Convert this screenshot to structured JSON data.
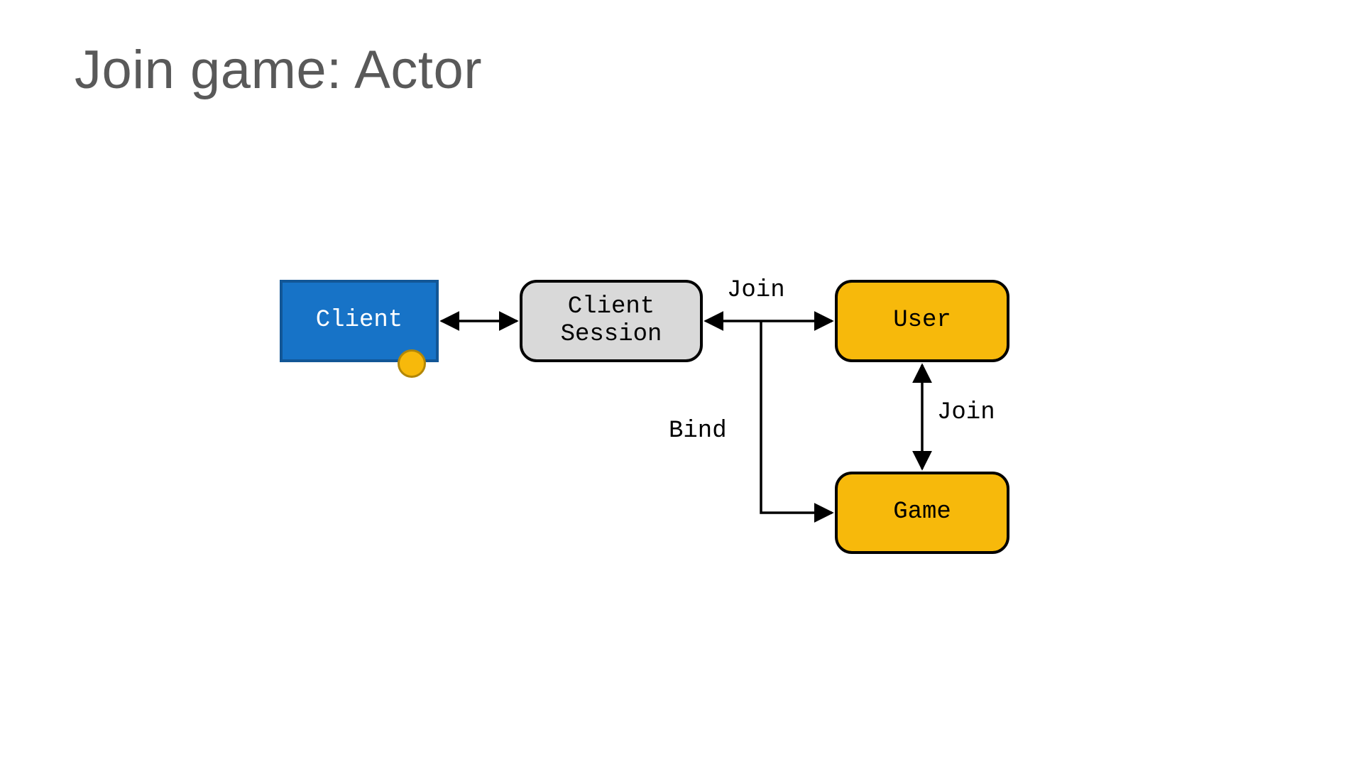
{
  "title": "Join game: Actor",
  "nodes": {
    "client": "Client",
    "session": "Client\nSession",
    "user": "User",
    "game": "Game"
  },
  "edges": {
    "join_top": "Join",
    "join_right": "Join",
    "bind": "Bind"
  },
  "colors": {
    "blue": "#1773c7",
    "amber": "#f7b90b",
    "grey": "#d9d9d9",
    "title": "#595959"
  }
}
